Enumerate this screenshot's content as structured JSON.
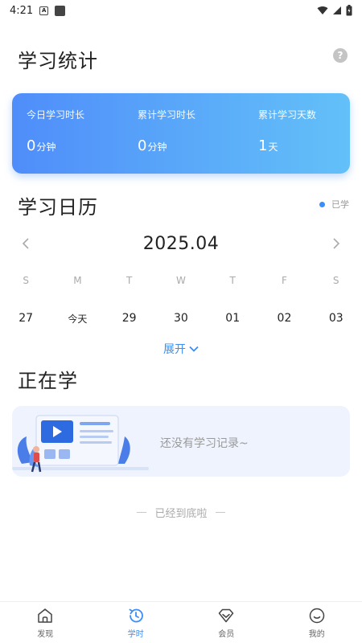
{
  "status": {
    "time": "4:21"
  },
  "page": {
    "title": "学习统计",
    "help_icon": "question-icon"
  },
  "stats": [
    {
      "label": "今日学习时长",
      "value": "0",
      "unit": "分钟"
    },
    {
      "label": "累计学习时长",
      "value": "0",
      "unit": "分钟"
    },
    {
      "label": "累计学习天数",
      "value": "1",
      "unit": "天"
    }
  ],
  "calendar": {
    "title": "学习日历",
    "legend": "已学",
    "month": "2025.04",
    "weekdays": [
      "S",
      "M",
      "T",
      "W",
      "T",
      "F",
      "S"
    ],
    "days": [
      "27",
      "今天",
      "29",
      "30",
      "01",
      "02",
      "03"
    ],
    "expand": "展开"
  },
  "learning": {
    "title": "正在学",
    "empty_text": "还没有学习记录~"
  },
  "footer": {
    "end_text": "已经到底啦"
  },
  "tabbar": [
    {
      "label": "发现",
      "icon": "home-icon"
    },
    {
      "label": "学时",
      "icon": "history-clock-icon",
      "active": true
    },
    {
      "label": "会员",
      "icon": "diamond-icon"
    },
    {
      "label": "我的",
      "icon": "smile-face-icon"
    }
  ],
  "colors": {
    "accent": "#3a8ef6",
    "card_gradient_start": "#4f8dfa",
    "card_gradient_end": "#63c0f8",
    "empty_card_bg": "#eef3fd"
  }
}
